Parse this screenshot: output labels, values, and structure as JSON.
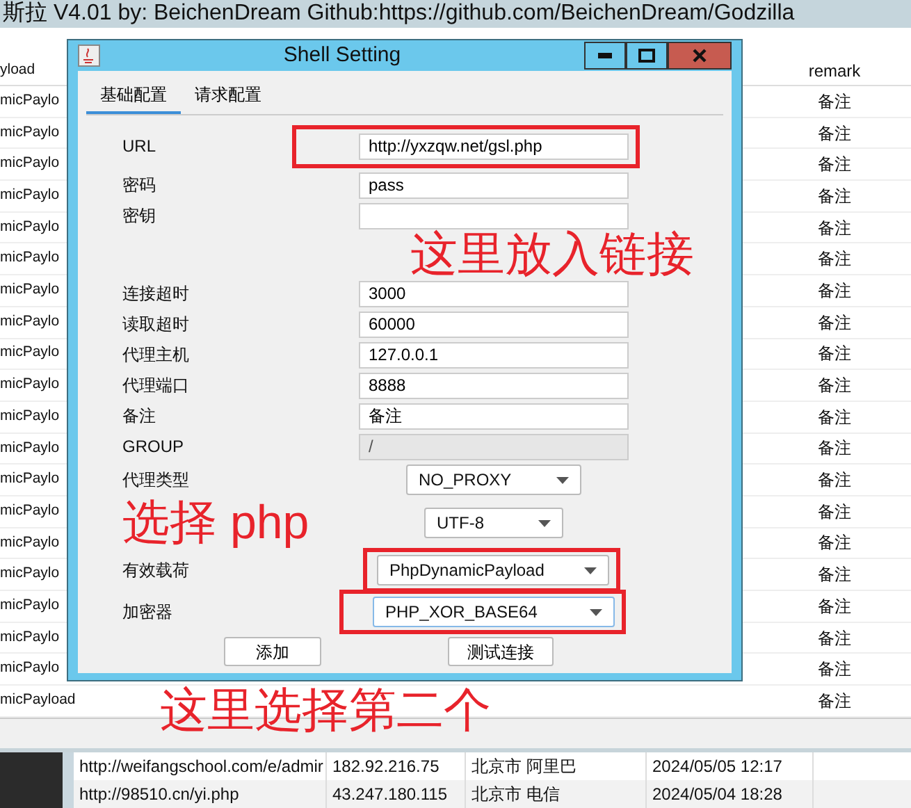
{
  "main_window": {
    "title": "斯拉  V4.01 by: BeichenDream Github:https://github.com/BeichenDream/Godzilla"
  },
  "shell_table": {
    "columns": [
      "yload",
      "remark"
    ],
    "rows": [
      {
        "payload": "micPaylo",
        "remark": "备注"
      },
      {
        "payload": "micPaylo",
        "remark": "备注"
      },
      {
        "payload": "micPaylo",
        "remark": "备注"
      },
      {
        "payload": "micPaylo",
        "remark": "备注"
      },
      {
        "payload": "micPaylo",
        "remark": "备注"
      },
      {
        "payload": "micPaylo",
        "remark": "备注"
      },
      {
        "payload": "micPaylo",
        "remark": "备注"
      },
      {
        "payload": "micPaylo",
        "remark": "备注"
      },
      {
        "payload": "micPaylo",
        "remark": "备注"
      },
      {
        "payload": "micPaylo",
        "remark": "备注"
      },
      {
        "payload": "micPaylo",
        "remark": "备注"
      },
      {
        "payload": "micPaylo",
        "remark": "备注"
      },
      {
        "payload": "micPaylo",
        "remark": "备注"
      },
      {
        "payload": "micPaylo",
        "remark": "备注"
      },
      {
        "payload": "micPaylo",
        "remark": "备注"
      },
      {
        "payload": "micPaylo",
        "remark": "备注"
      },
      {
        "payload": "micPaylo",
        "remark": "备注"
      },
      {
        "payload": "micPaylo",
        "remark": "备注"
      },
      {
        "payload": "micPaylo",
        "remark": "备注"
      },
      {
        "payload": "micPayload",
        "remark": "备注"
      }
    ]
  },
  "dialog": {
    "title": "Shell Setting",
    "tabs": [
      {
        "label": "基础配置",
        "selected": true
      },
      {
        "label": "请求配置",
        "selected": false
      }
    ],
    "fields": [
      {
        "label": "URL",
        "value": "http://yxzqw.net/gsl.php",
        "disabled": false
      },
      {
        "label": "密码",
        "value": "pass",
        "disabled": false
      },
      {
        "label": "密钥",
        "disabled": false
      },
      {
        "label": "连接超时",
        "value": "3000",
        "disabled": false
      },
      {
        "label": "读取超时",
        "value": "60000",
        "disabled": false
      },
      {
        "label": "代理主机",
        "value": "127.0.0.1",
        "disabled": false
      },
      {
        "label": "代理端口",
        "value": "8888",
        "disabled": false
      },
      {
        "label": "备注",
        "value": "备注",
        "disabled": false
      },
      {
        "label": "GROUP",
        "value": "/",
        "disabled": true
      }
    ],
    "selects": [
      {
        "label": "代理类型",
        "value": "NO_PROXY",
        "focused": false
      },
      {
        "value": "UTF-8",
        "focused": false
      },
      {
        "label": "有效载荷",
        "value": "PhpDynamicPayload",
        "focused": false
      },
      {
        "label": "加密器",
        "value": "PHP_XOR_BASE64",
        "focused": true
      }
    ],
    "buttons": [
      "添加",
      "测试连接"
    ]
  },
  "bottom_table": {
    "rows": [
      [
        "http://weifangschool.com/e/admir",
        "182.92.216.75",
        "北京市 阿里巴",
        "2024/05/05 12:17"
      ],
      [
        "http://98510.cn/yi.php",
        "43.247.180.115",
        "北京市 电信",
        "2024/05/04 18:28"
      ]
    ]
  },
  "annotations": [
    {
      "kind": "box"
    },
    {
      "kind": "text",
      "text": "这里放入链接"
    },
    {
      "kind": "text",
      "text": "选择 php"
    },
    {
      "kind": "box"
    },
    {
      "kind": "box"
    },
    {
      "kind": "text",
      "text": "这里选择第二个"
    }
  ]
}
